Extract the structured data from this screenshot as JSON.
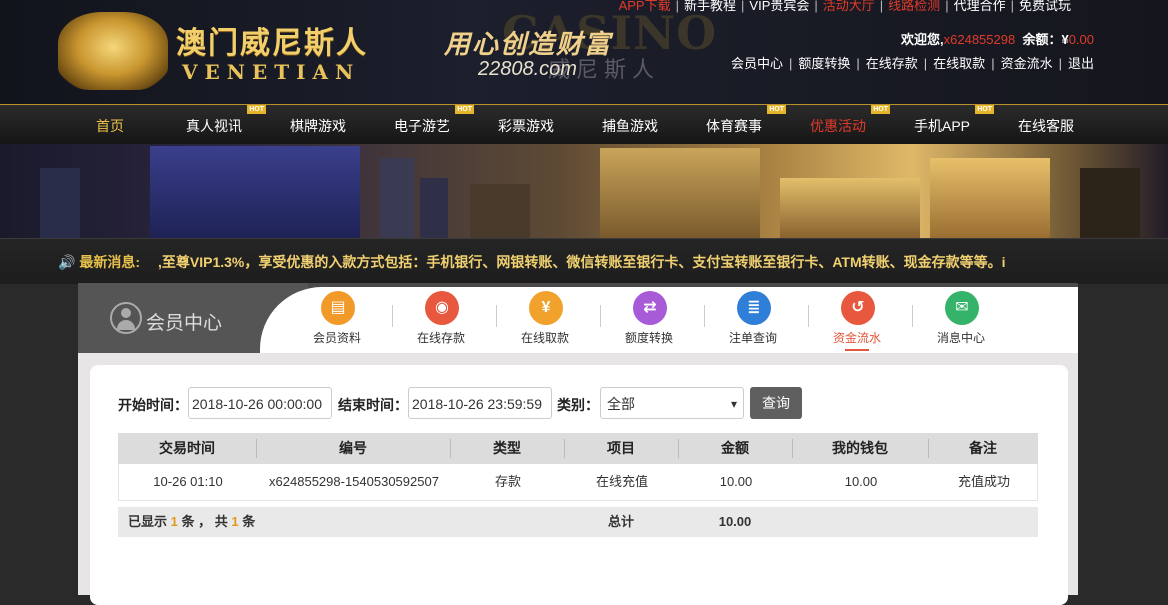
{
  "header": {
    "logo_cn": "澳门威尼斯人",
    "logo_en": "VENETIAN",
    "slogan_bg": "CASINO",
    "slogan_bg_cn": "威尼斯人",
    "slogan_main": "用心创造财富",
    "slogan_domain": "22808.com",
    "top_links": [
      "APP下载",
      "新手教程",
      "VIP贵宾会",
      "活动大厅",
      "线路检测",
      "代理合作",
      "免费试玩"
    ],
    "welcome_label": "欢迎您,",
    "username": "x624855298",
    "balance_label": "余额：¥",
    "balance": "0.00",
    "user_links": [
      "会员中心",
      "额度转换",
      "在线存款",
      "在线取款",
      "资金流水",
      "退出"
    ]
  },
  "nav": {
    "hot_label": "HOT",
    "items": [
      {
        "label": "首页"
      },
      {
        "label": "真人视讯"
      },
      {
        "label": "棋牌游戏"
      },
      {
        "label": "电子游艺"
      },
      {
        "label": "彩票游戏"
      },
      {
        "label": "捕鱼游戏"
      },
      {
        "label": "体育赛事"
      },
      {
        "label": "优惠活动"
      },
      {
        "label": "手机APP"
      },
      {
        "label": "在线客服"
      }
    ]
  },
  "news": {
    "label": "最新消息:",
    "text": ",至尊VIP1.3%，享受优惠的入款方式包括：手机银行、网银转账、微信转账至银行卡、支付宝转账至银行卡、ATM转账、现金存款等等。i"
  },
  "member": {
    "title": "会员中心",
    "tabs": [
      {
        "label": "会员资料",
        "color": "#f19a2a",
        "glyph": "▤"
      },
      {
        "label": "在线存款",
        "color": "#e8583e",
        "glyph": "◉"
      },
      {
        "label": "在线取款",
        "color": "#f0a22c",
        "glyph": "¥"
      },
      {
        "label": "额度转换",
        "color": "#a75bd6",
        "glyph": "⇄"
      },
      {
        "label": "注单查询",
        "color": "#2f7ed8",
        "glyph": "≣"
      },
      {
        "label": "资金流水",
        "color": "#e8583e",
        "glyph": "↺"
      },
      {
        "label": "消息中心",
        "color": "#35b36a",
        "glyph": "✉"
      }
    ]
  },
  "filter": {
    "start_label": "开始时间：",
    "start_value": "2018-10-26 00:00:00",
    "end_label": "结束时间：",
    "end_value": "2018-10-26 23:59:59",
    "type_label": "类别：",
    "type_value": "全部",
    "query_label": "查询"
  },
  "table": {
    "headers": [
      "交易时间",
      "编号",
      "类型",
      "项目",
      "金额",
      "我的钱包",
      "备注"
    ],
    "rows": [
      [
        "10-26 01:10",
        "x624855298-1540530592507",
        "存款",
        "在线充值",
        "10.00",
        "10.00",
        "充值成功"
      ]
    ],
    "footer": {
      "shown_prefix": "已显示",
      "shown_count": "1",
      "shown_mid": "条 ， 共",
      "total_count": "1",
      "shown_suffix": "条",
      "total_label": "总计",
      "total_amount": "10.00"
    }
  },
  "colors": {
    "accent_gold": "#f1c24a",
    "accent_red": "#e23a2a",
    "active_tab": "#e2563a"
  }
}
